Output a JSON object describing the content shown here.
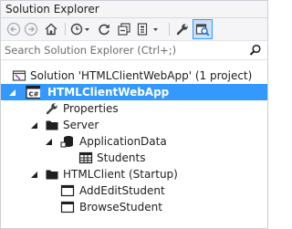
{
  "window": {
    "title": "Solution Explorer"
  },
  "toolbar": {
    "buttons": [
      {
        "icon": "back-arrow-icon"
      },
      {
        "icon": "forward-arrow-icon"
      },
      {
        "icon": "home-icon"
      },
      {
        "icon": "history-clock-icon"
      },
      {
        "icon": "refresh-icon"
      },
      {
        "icon": "collapse-all-icon"
      },
      {
        "icon": "show-all-files-icon"
      },
      {
        "icon": "properties-wrench-icon"
      },
      {
        "icon": "preview-icon"
      }
    ]
  },
  "search": {
    "placeholder": "Search Solution Explorer (Ctrl+;)"
  },
  "tree": {
    "solution": "Solution 'HTMLClientWebApp' (1 project)",
    "project": "HTMLClientWebApp",
    "properties": "Properties",
    "server": "Server",
    "application_data": "ApplicationData",
    "students": "Students",
    "htmlclient": "HTMLClient (Startup)",
    "add_edit_student": "AddEditStudent",
    "browse_student": "BrowseStudent"
  },
  "colors": {
    "selection": "#3399ff",
    "accent": "#1e6fc8"
  }
}
